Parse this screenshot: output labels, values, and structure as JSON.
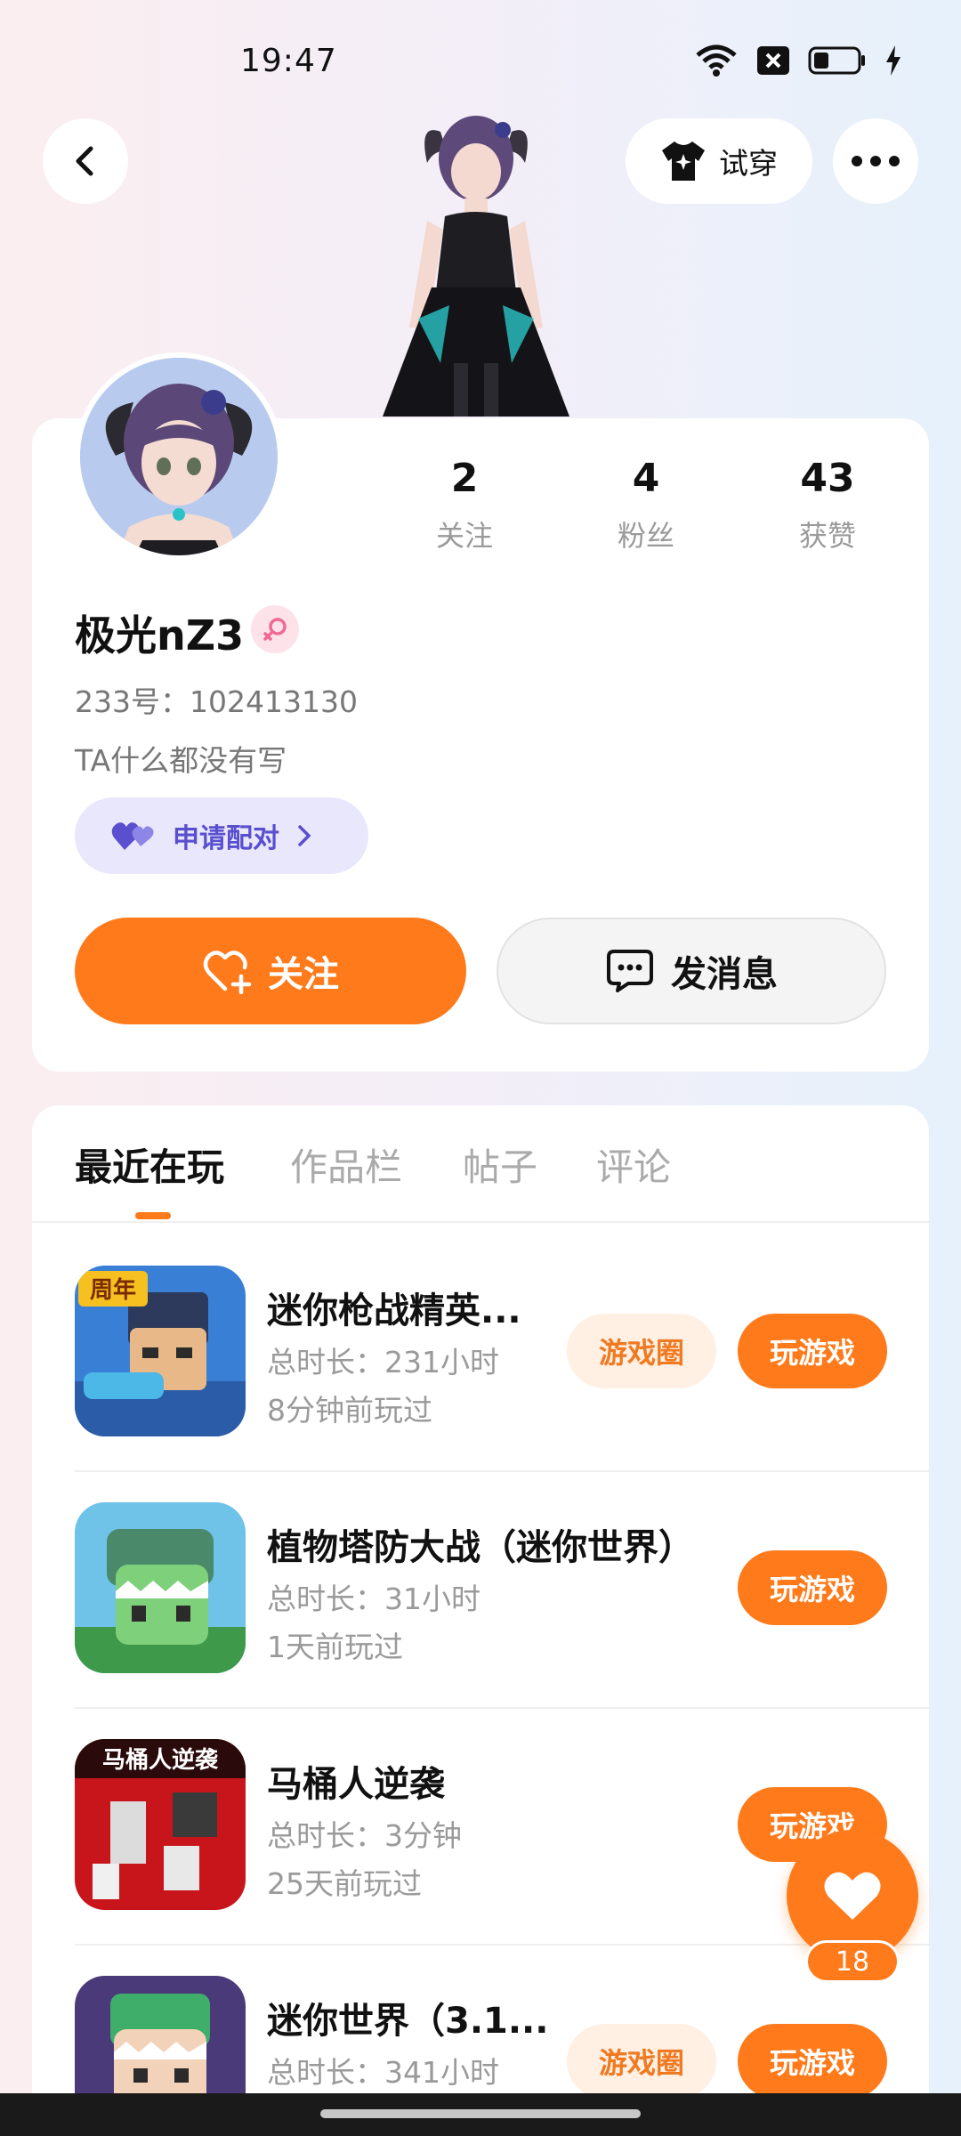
{
  "status_bar": {
    "time": "19:47"
  },
  "header": {
    "tryon_label": "试穿"
  },
  "profile": {
    "stats": [
      {
        "value": "2",
        "label": "关注"
      },
      {
        "value": "4",
        "label": "粉丝"
      },
      {
        "value": "43",
        "label": "获赞"
      }
    ],
    "username": "极光nZ3",
    "uid": "233号：102413130",
    "bio": "TA什么都没有写",
    "pair_label": "申请配对",
    "follow_label": "关注",
    "message_label": "发消息"
  },
  "tabs": [
    {
      "label": "最近在玩",
      "active": true
    },
    {
      "label": "作品栏",
      "active": false
    },
    {
      "label": "帖子",
      "active": false
    },
    {
      "label": "评论",
      "active": false
    }
  ],
  "games": [
    {
      "title": "迷你枪战精英...",
      "duration": "总时长：231小时",
      "last_played": "8分钟前玩过",
      "circle_label": "游戏圈",
      "play_label": "玩游戏",
      "icon_text": "周年"
    },
    {
      "title": "植物塔防大战（迷你世界）",
      "duration": "总时长：31小时",
      "last_played": "1天前玩过",
      "circle_label": "",
      "play_label": "玩游戏",
      "icon_text": ""
    },
    {
      "title": "马桶人逆袭",
      "duration": "总时长：3分钟",
      "last_played": "25天前玩过",
      "circle_label": "",
      "play_label": "玩游戏",
      "icon_text": "马桶人逆袭"
    },
    {
      "title": "迷你世界（3.1...",
      "duration": "总时长：341小时",
      "last_played": "",
      "circle_label": "游戏圈",
      "play_label": "玩游戏",
      "icon_text": ""
    }
  ],
  "floating_like": {
    "count": "18"
  },
  "colors": {
    "accent": "#ff7a1a",
    "pair": "#5a4fcf"
  }
}
